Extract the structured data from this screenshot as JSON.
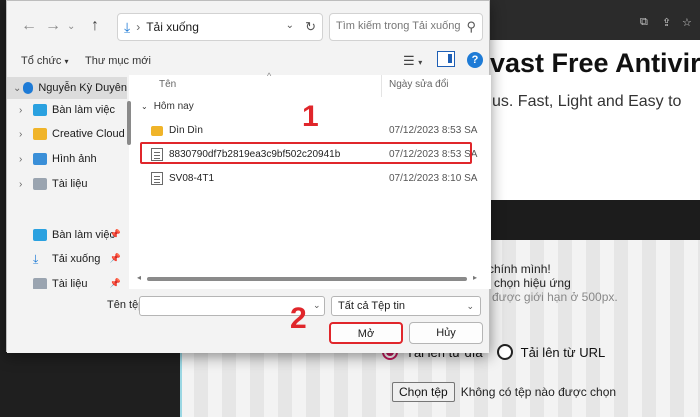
{
  "browser": {
    "page_title": "vast Free Antiviru",
    "page_subtitle": "us. Fast, Light and Easy to",
    "info_lines": [
      "h chính mình!",
      "và chọn hiệu ứng",
      "được giới hạn ở 500px."
    ],
    "radio_upload_label": "Tải lên từ đĩa",
    "radio_url_label": "Tải lên từ URL",
    "choose_file_button": "Chọn tệp",
    "no_file_text": "Không có tệp nào được chọn"
  },
  "dialog": {
    "address_folder": "Tải xuống",
    "search_placeholder": "Tìm kiếm trong Tải xuống",
    "toolbar": {
      "organize": "Tổ chức",
      "new_folder": "Thư mục mới"
    },
    "sidebar": {
      "items": [
        {
          "label": "Nguyễn Kỳ Duyên",
          "icon": "cloud-icon"
        },
        {
          "label": "Bàn làm việc",
          "icon": "desktop-icon"
        },
        {
          "label": "Creative Cloud",
          "icon": "folder-icon"
        },
        {
          "label": "Hình ảnh",
          "icon": "pictures-icon"
        },
        {
          "label": "Tài liệu",
          "icon": "documents-icon"
        },
        {
          "label": "Bàn làm việc",
          "icon": "desktop-icon"
        },
        {
          "label": "Tải xuống",
          "icon": "download-icon"
        },
        {
          "label": "Tài liệu",
          "icon": "documents-icon"
        }
      ]
    },
    "columns": {
      "name": "Tên",
      "date": "Ngày sửa đổi"
    },
    "group_label": "Hôm nay",
    "files": [
      {
        "name": "Dìn Dìn",
        "date": "07/12/2023 8:53 SA",
        "kind": "folder"
      },
      {
        "name": "8830790df7b2819ea3c9bf502c20941b",
        "date": "07/12/2023 8:53 SA",
        "kind": "file"
      },
      {
        "name": "SV08-4T1",
        "date": "07/12/2023 8:10 SA",
        "kind": "file"
      }
    ],
    "filename_label": "Tên tệp:",
    "filename_value": "",
    "filetype_value": "Tất cả Tệp tin",
    "open_button": "Mở",
    "cancel_button": "Hủy"
  },
  "annotations": {
    "step1": "1",
    "step2": "2",
    "highlight_color": "#e0262b"
  }
}
